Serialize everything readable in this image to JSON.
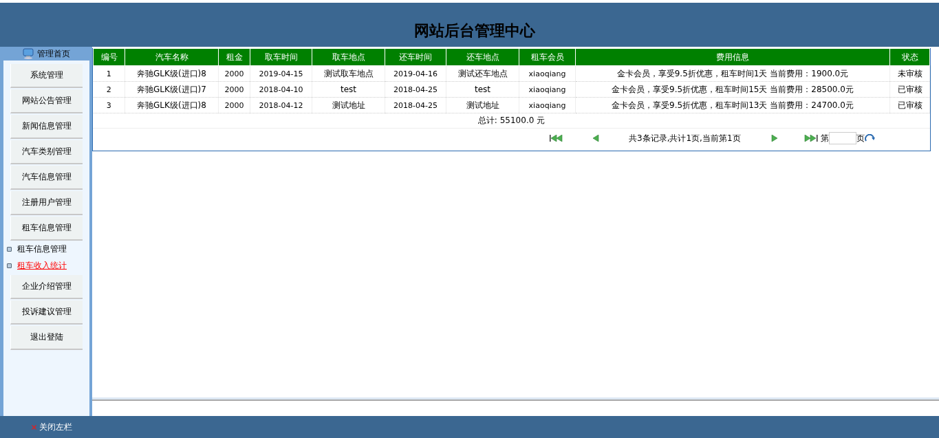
{
  "header": {
    "title": "网站后台管理中心"
  },
  "sidebar": {
    "home": "管理首页",
    "items": [
      {
        "kind": "section",
        "label": "系统管理"
      },
      {
        "kind": "section",
        "label": "网站公告管理"
      },
      {
        "kind": "section",
        "label": "新闻信息管理"
      },
      {
        "kind": "section",
        "label": "汽车类别管理"
      },
      {
        "kind": "section",
        "label": "汽车信息管理"
      },
      {
        "kind": "section",
        "label": "注册用户管理"
      },
      {
        "kind": "section",
        "label": "租车信息管理"
      },
      {
        "kind": "link",
        "label": "租车信息管理",
        "selected": false
      },
      {
        "kind": "link",
        "label": "租车收入统计",
        "selected": true
      },
      {
        "kind": "section",
        "label": "企业介绍管理"
      },
      {
        "kind": "section",
        "label": "投诉建议管理"
      },
      {
        "kind": "section",
        "label": "退出登陆"
      }
    ]
  },
  "table": {
    "columns": [
      "编号",
      "汽车名称",
      "租金",
      "取车时间",
      "取车地点",
      "还车时间",
      "还车地点",
      "租车会员",
      "费用信息",
      "状态"
    ],
    "rows": [
      [
        "1",
        "奔驰GLK级(进口)8",
        "2000",
        "2019-04-15",
        "测试取车地点",
        "2019-04-16",
        "测试还车地点",
        "xiaoqiang",
        "金卡会员，享受9.5折优惠，租车时间1天 当前费用：1900.0元",
        "未审核"
      ],
      [
        "2",
        "奔驰GLK级(进口)7",
        "2000",
        "2018-04-10",
        "test",
        "2018-04-25",
        "test",
        "xiaoqiang",
        "金卡会员，享受9.5折优惠，租车时间15天 当前费用：28500.0元",
        "已审核"
      ],
      [
        "3",
        "奔驰GLK级(进口)8",
        "2000",
        "2018-04-12",
        "测试地址",
        "2018-04-25",
        "测试地址",
        "xiaoqiang",
        "金卡会员，享受9.5折优惠，租车时间13天 当前费用：24700.0元",
        "已审核"
      ]
    ],
    "total": "总计: 55100.0 元"
  },
  "pagination": {
    "info": "共3条记录,共计1页,当前第1页",
    "page_prefix": "第",
    "page_suffix": "页"
  },
  "footer": {
    "close_sidebar": "关闭左栏"
  }
}
